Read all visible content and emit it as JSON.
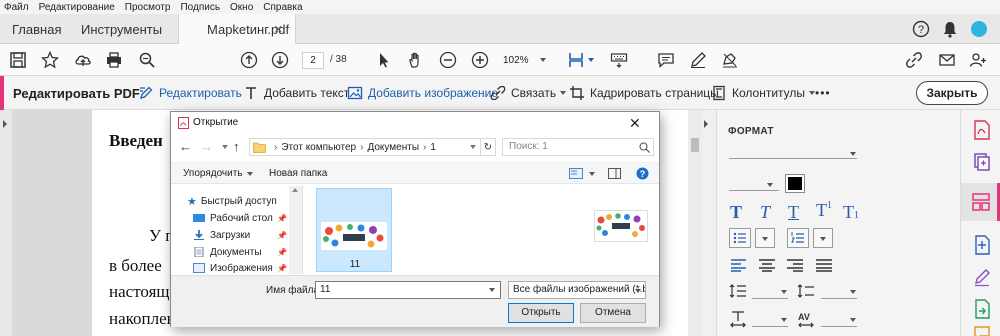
{
  "menu": [
    "Файл",
    "Редактирование",
    "Просмотр",
    "Подпись",
    "Окно",
    "Справка"
  ],
  "tabs": {
    "home": "Главная",
    "tools": "Инструменты",
    "document": "Марketинг.pdf"
  },
  "toolbar": {
    "page_current": "2",
    "page_total": "/ 38",
    "zoom": "102%"
  },
  "editbar": {
    "title": "Редактировать PDF",
    "edit": "Редактировать",
    "add_text": "Добавить текст",
    "add_image": "Добавить изображение",
    "link": "Связать",
    "crop": "Кадрировать страницы",
    "header_footer": "Колонтитулы",
    "more": "•••",
    "close": "Закрыть"
  },
  "document": {
    "heading": "Введен",
    "line1": "У п",
    "line2": "в  более",
    "line3": "настояще",
    "line4": "накоплен"
  },
  "format_panel": {
    "title": "ФОРМАТ"
  },
  "dialog": {
    "title": "Открытие",
    "breadcrumb": [
      "Этот компьютер",
      "Документы",
      "1"
    ],
    "search_placeholder": "Поиск: 1",
    "organize": "Упорядочить",
    "new_folder": "Новая папка",
    "nav": [
      {
        "label": "Быстрый доступ"
      },
      {
        "label": "Рабочий стол"
      },
      {
        "label": "Загрузки"
      },
      {
        "label": "Документы"
      },
      {
        "label": "Изображения"
      }
    ],
    "file_name": "11",
    "filename_label": "Имя файла:",
    "filename_value": "11",
    "filetype": "Все файлы изображений (*.br",
    "open_button": "Открыть",
    "cancel_button": "Отмена"
  },
  "colors": {
    "accent": "#e5337a",
    "blue": "#1c5fad",
    "selection": "#cce8ff"
  }
}
